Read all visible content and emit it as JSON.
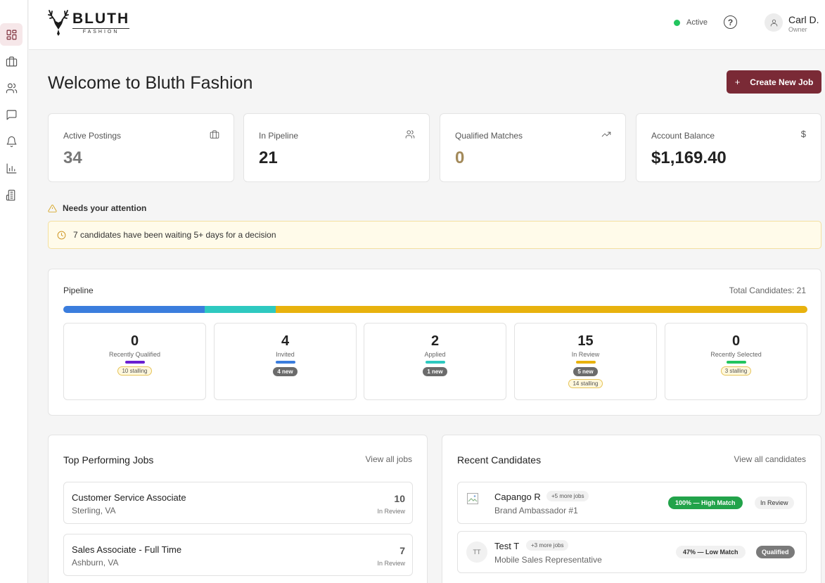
{
  "brand": {
    "name": "BLUTH",
    "sub": "FASHION"
  },
  "header": {
    "status": "Active",
    "help": "?",
    "user_name": "Carl D.",
    "user_role": "Owner"
  },
  "page": {
    "title": "Welcome to Bluth Fashion",
    "create_label": "Create New Job",
    "create_icon": "+"
  },
  "stats": [
    {
      "label": "Active Postings",
      "value": "34",
      "icon": "briefcase-icon",
      "color": "#777777"
    },
    {
      "label": "In Pipeline",
      "value": "21",
      "icon": "users-icon",
      "color": "#222222"
    },
    {
      "label": "Qualified Matches",
      "value": "0",
      "icon": "trending-up-icon",
      "color": "#a38a5a"
    },
    {
      "label": "Account Balance",
      "value": "$1,169.40",
      "icon": "$",
      "color": "#222222"
    }
  ],
  "attention": {
    "title": "Needs your attention",
    "alert": "7 candidates have been waiting 5+ days for a decision"
  },
  "pipeline": {
    "title": "Pipeline",
    "total": "Total Candidates: 21",
    "bar": [
      {
        "fraction": 0.19,
        "color": "#3b7ddd"
      },
      {
        "fraction": 0.095,
        "color": "#2ec9c0"
      },
      {
        "fraction": 0.715,
        "color": "#e8b20e"
      }
    ],
    "stages": [
      {
        "count": "0",
        "label": "Recently Qualified",
        "color": "#6a1fd1",
        "new": "",
        "stalling": "10 stalling"
      },
      {
        "count": "4",
        "label": "Invited",
        "color": "#3b7ddd",
        "new": "4 new",
        "stalling": ""
      },
      {
        "count": "2",
        "label": "Applied",
        "color": "#2ec9c0",
        "new": "1 new",
        "stalling": ""
      },
      {
        "count": "15",
        "label": "In Review",
        "color": "#e8b20e",
        "new": "5 new",
        "stalling": "14 stalling"
      },
      {
        "count": "0",
        "label": "Recently Selected",
        "color": "#22c55e",
        "new": "",
        "stalling": "3 stalling"
      }
    ]
  },
  "top_jobs": {
    "title": "Top Performing Jobs",
    "link": "View all jobs",
    "items": [
      {
        "title": "Customer Service Associate",
        "location": "Sterling, VA",
        "count": "10",
        "status": "In Review"
      },
      {
        "title": "Sales Associate - Full Time",
        "location": "Ashburn, VA",
        "count": "7",
        "status": "In Review"
      }
    ]
  },
  "recent_candidates": {
    "title": "Recent Candidates",
    "link": "View all candidates",
    "items": [
      {
        "initials": "",
        "name": "Capango R",
        "more": "+5 more jobs",
        "job": "Brand Ambassador #1",
        "match": "100% — High Match",
        "match_bg": "#22a34a",
        "match_fg": "#ffffff",
        "status": "In Review",
        "status_bg": "#f1f1f1",
        "status_fg": "#333333"
      },
      {
        "initials": "TT",
        "name": "Test T",
        "more": "+3 more jobs",
        "job": "Mobile Sales Representative",
        "match": "47% — Low Match",
        "match_bg": "#f1f1f1",
        "match_fg": "#333333",
        "status": "Qualified",
        "status_bg": "#7a7a7a",
        "status_fg": "#ffffff"
      }
    ]
  }
}
